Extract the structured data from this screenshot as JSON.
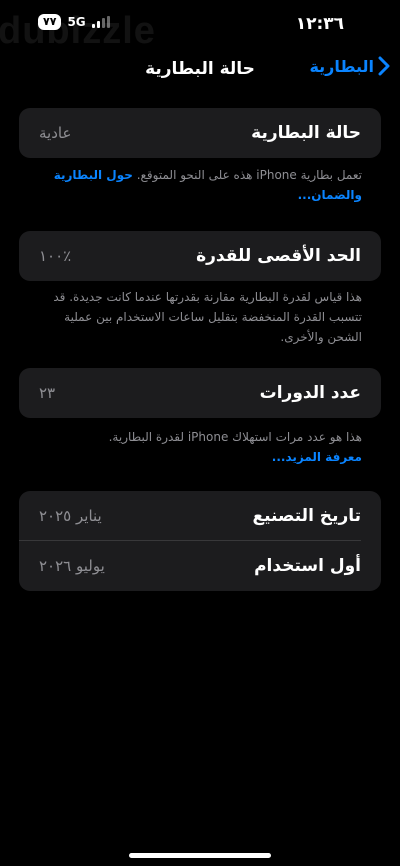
{
  "status": {
    "battery_level": "٧٧",
    "network": "5G",
    "time": "١٢:٣٦"
  },
  "watermark": "dubizzle",
  "nav": {
    "title": "حالة البطارية",
    "back_label": "البطارية"
  },
  "health": {
    "label": "حالة البطارية",
    "value": "عادية",
    "note": "تعمل بطارية iPhone هذه على النحو المتوقع.",
    "note_link": "حول البطارية والضمان..."
  },
  "max_capacity": {
    "label": "الحد الأقصى للقدرة",
    "value": "٪١٠٠",
    "note": "هذا قياس لقدرة البطارية مقارنة بقدرتها عندما كانت جديدة. قد تتسبب القدرة المنخفضة بتقليل ساعات الاستخدام بين عملية الشحن والأخرى."
  },
  "cycles": {
    "label": "عدد الدورات",
    "value": "٢٣",
    "note": "هذا هو عدد مرات استهلاك iPhone لقدرة البطارية.",
    "note_link": "معرفة المزيد..."
  },
  "dates": {
    "manufacture_label": "تاريخ التصنيع",
    "manufacture_value": "يناير ٢٠٢٥",
    "first_use_label": "أول استخدام",
    "first_use_value": "يوليو ٢٠٢٦"
  },
  "colors": {
    "background": "#000000",
    "card": "#1c1c1e",
    "accent": "#0a84ff",
    "secondary_text": "#8e8e93"
  },
  "icons": {
    "back": "chevron-left-icon",
    "signal": "cellular-signal-icon"
  }
}
